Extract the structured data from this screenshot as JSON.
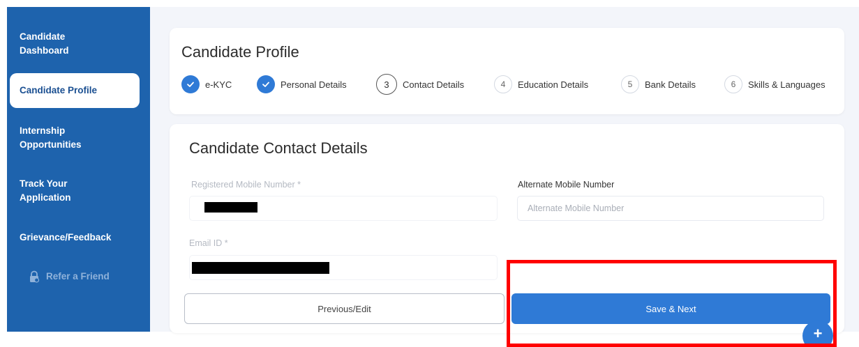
{
  "sidebar": {
    "items": [
      {
        "label": "Candidate Dashboard"
      },
      {
        "label": "Candidate Profile"
      },
      {
        "label": "Internship Opportunities"
      },
      {
        "label": "Track Your Application"
      },
      {
        "label": "Grievance/Feedback"
      },
      {
        "label": "Refer a Friend"
      }
    ]
  },
  "header": {
    "title": "Candidate Profile",
    "steps": [
      {
        "number": "",
        "label": "e-KYC",
        "status": "completed"
      },
      {
        "number": "",
        "label": "Personal Details",
        "status": "completed"
      },
      {
        "number": "3",
        "label": "Contact Details",
        "status": "current"
      },
      {
        "number": "4",
        "label": "Education Details",
        "status": "pending"
      },
      {
        "number": "5",
        "label": "Bank Details",
        "status": "pending"
      },
      {
        "number": "6",
        "label": "Skills & Languages",
        "status": "pending"
      }
    ]
  },
  "form": {
    "title": "Candidate Contact Details",
    "registered_mobile": {
      "label": "Registered Mobile Number *",
      "value": ""
    },
    "alternate_mobile": {
      "label": "Alternate Mobile Number",
      "placeholder": "Alternate Mobile Number",
      "value": ""
    },
    "email": {
      "label": "Email ID *",
      "value": ""
    }
  },
  "actions": {
    "previous_label": "Previous/Edit",
    "save_label": "Save & Next"
  },
  "fab": {
    "symbol": "+"
  },
  "colors": {
    "sidebar": "#1e63ad",
    "primary": "#2f7ad6",
    "highlight": "#ff0000",
    "background": "#f3f5fa"
  },
  "icons": {
    "step_completed": "check-icon",
    "refer": "lock-icon"
  }
}
